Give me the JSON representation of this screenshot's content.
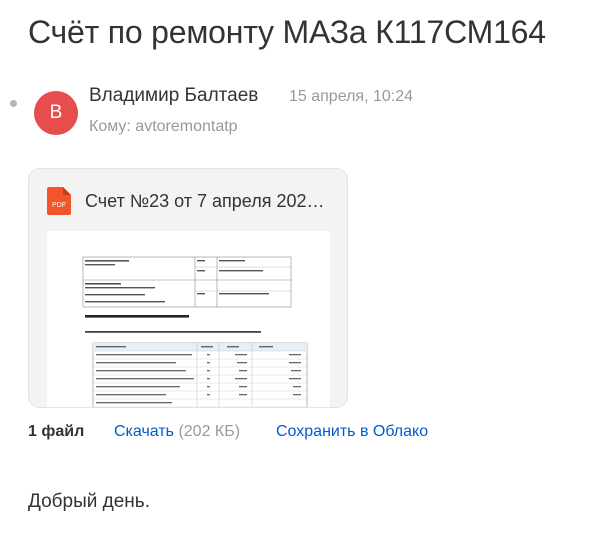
{
  "subject": "Счёт по ремонту МАЗа К117СМ164",
  "sender": {
    "avatar_letter": "В",
    "name": "Владимир Балтаев",
    "date": "15 апреля, 10:24",
    "recipient": "Кому: avtoremontatp"
  },
  "attachment": {
    "icon": "pdf-icon",
    "icon_label": "PDF",
    "name": "Счет №23 от 7 апреля 202…",
    "preview_title": "Счет на оплату №23 от 07 апреля 2020г.",
    "preview_sub": "Исполнитель: ИП Балтаев В. Покупатель: ООО АВТОРЕМОНТ А"
  },
  "actions": {
    "files_count": "1 файл",
    "download_label": "Скачать",
    "download_size": "(202 КБ)",
    "save_cloud_label": "Сохранить в Облако"
  },
  "body": {
    "greeting": "Добрый день."
  },
  "colors": {
    "avatar": "#e84d4d",
    "link": "#005bd1",
    "muted": "#999999",
    "pdf": "#f2552c"
  }
}
